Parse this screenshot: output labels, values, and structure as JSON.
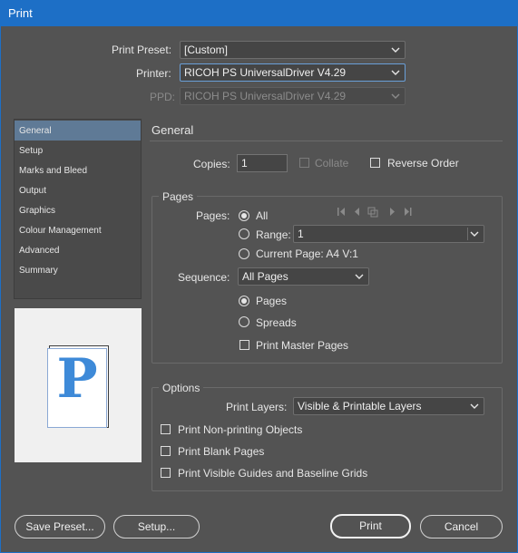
{
  "window": {
    "title": "Print"
  },
  "header": {
    "print_preset_label": "Print Preset:",
    "print_preset_value": "[Custom]",
    "printer_label": "Printer:",
    "printer_value": "RICOH PS UniversalDriver V4.29",
    "ppd_label": "PPD:",
    "ppd_value": "RICOH PS UniversalDriver V4.29"
  },
  "sidebar": {
    "items": [
      {
        "label": "General"
      },
      {
        "label": "Setup"
      },
      {
        "label": "Marks and Bleed"
      },
      {
        "label": "Output"
      },
      {
        "label": "Graphics"
      },
      {
        "label": "Colour Management"
      },
      {
        "label": "Advanced"
      },
      {
        "label": "Summary"
      }
    ],
    "selected": "General"
  },
  "preview": {
    "page_letter": "P"
  },
  "general": {
    "title": "General",
    "copies_label": "Copies:",
    "copies_value": "1",
    "collate_label": "Collate",
    "reverse_order_label": "Reverse Order"
  },
  "pages": {
    "title": "Pages",
    "pages_label": "Pages:",
    "all_label": "All",
    "range_label": "Range:",
    "range_value": "1",
    "current_page_label": "Current Page: A4 V:1",
    "sequence_label": "Sequence:",
    "sequence_value": "All Pages",
    "pages_radio_label": "Pages",
    "spreads_radio_label": "Spreads",
    "print_master_pages_label": "Print Master Pages"
  },
  "options": {
    "title": "Options",
    "print_layers_label": "Print Layers:",
    "print_layers_value": "Visible & Printable Layers",
    "non_printing_label": "Print Non-printing Objects",
    "blank_pages_label": "Print Blank Pages",
    "guides_label": "Print Visible Guides and Baseline Grids"
  },
  "buttons": {
    "save_preset": "Save Preset...",
    "setup": "Setup...",
    "print": "Print",
    "cancel": "Cancel"
  },
  "colors": {
    "titlebar": "#1d6fc6",
    "background": "#535353",
    "selected_item": "#5f7a96",
    "preview_letter": "#3e8ad8"
  }
}
